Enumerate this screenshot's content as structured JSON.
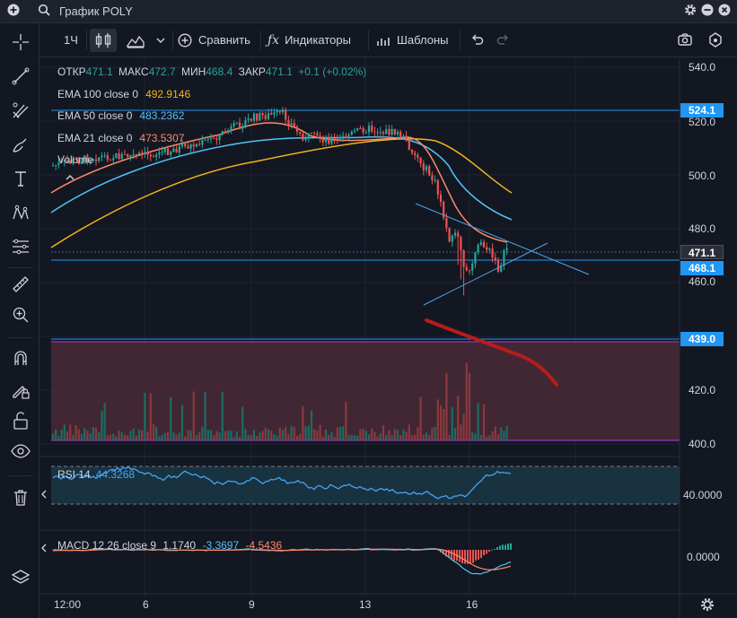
{
  "window": {
    "title": "График POLY"
  },
  "toolbar": {
    "interval": "1Ч",
    "compare_label": "Сравнить",
    "indicators_label": "Индикаторы",
    "templates_label": "Шаблоны"
  },
  "ohlc": {
    "open_label": "ОТКР",
    "open": "471.1",
    "high_label": "МАКС",
    "high": "472.7",
    "low_label": "МИН",
    "low": "468.4",
    "close_label": "ЗАКР",
    "close": "471.1",
    "change": "+0.1 (+0.02%)"
  },
  "indicators": [
    {
      "label": "EMA 100 close 0",
      "value": "492.9146",
      "color": "#f0b31b"
    },
    {
      "label": "EMA 50 close 0",
      "value": "483.2362",
      "color": "#4fc3f7"
    },
    {
      "label": "EMA 21 close 0",
      "value": "473.5307",
      "color": "#ff8a65"
    },
    {
      "label": "Volume",
      "value": ""
    }
  ],
  "price_axis": [
    "540.0",
    "520.0",
    "500.0",
    "480.0",
    "460.0",
    "420.0",
    "400.0"
  ],
  "price_badges": [
    {
      "label": "524.1",
      "color": "#2196f3"
    },
    {
      "label": "471.1",
      "color": "#2a2e39"
    },
    {
      "label": "468.1",
      "color": "#2196f3"
    },
    {
      "label": "439.0",
      "color": "#2196f3"
    }
  ],
  "rsi": {
    "label": "RSI 14",
    "value": "44.3268",
    "axis_value": "40.0000",
    "color": "#42a5f5"
  },
  "macd": {
    "label": "MACD 12 26 close 9",
    "v1": "1.1740",
    "v2": "-3.3697",
    "v3": "-4.5436",
    "axis_value": "0.0000"
  },
  "time_axis": [
    "12:00",
    "6",
    "9",
    "13",
    "16"
  ],
  "colors": {
    "up": "#26a69a",
    "down": "#ef5350",
    "background": "#131722",
    "accent": "#2196f3"
  }
}
